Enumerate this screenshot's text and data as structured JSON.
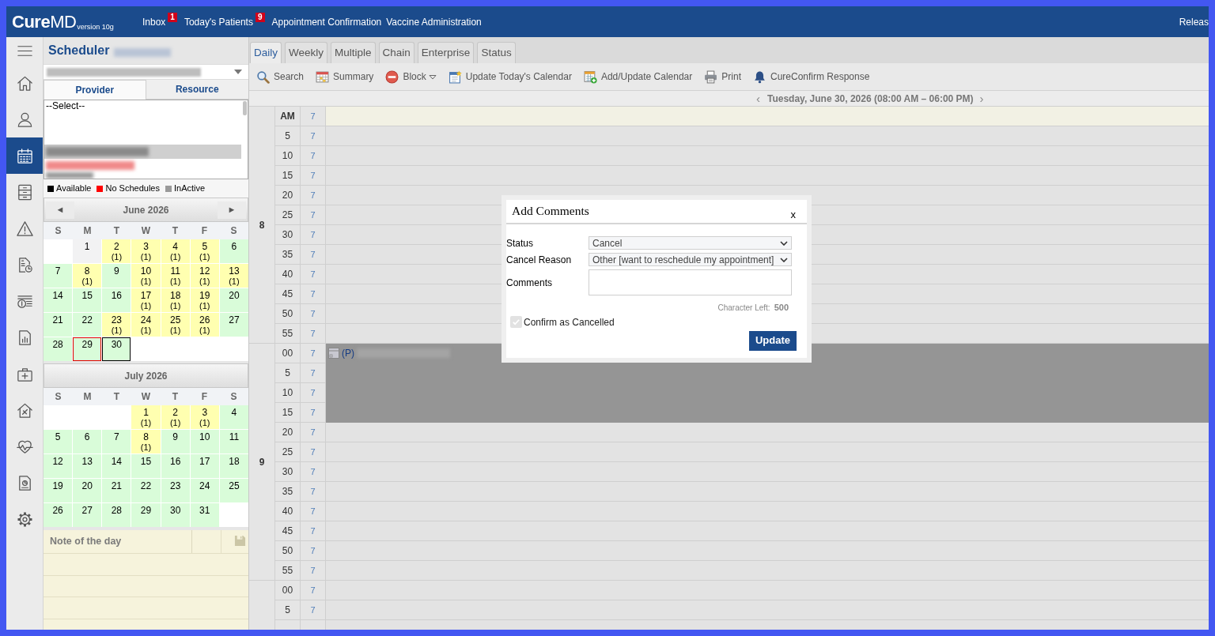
{
  "header": {
    "logo": "**Cure**MD",
    "version": "version 10g",
    "nav": [
      {
        "label": "Inbox",
        "badge": "1"
      },
      {
        "label": "Today's Patients",
        "badge": "9"
      },
      {
        "label": "Appointment Confirmation"
      },
      {
        "label": "Vaccine Administration"
      }
    ],
    "right_link": "Releas"
  },
  "rail": {
    "items": [
      {
        "kind": "menu",
        "selected": false
      },
      {
        "kind": "home",
        "selected": false
      },
      {
        "kind": "person",
        "selected": false
      },
      {
        "kind": "calendar",
        "selected": true
      },
      {
        "kind": "cabinet",
        "selected": false
      },
      {
        "kind": "warning",
        "selected": false
      },
      {
        "kind": "invoice",
        "selected": false
      },
      {
        "kind": "cash",
        "selected": false
      },
      {
        "kind": "report",
        "selected": false
      },
      {
        "kind": "bag",
        "selected": false
      },
      {
        "kind": "house",
        "selected": false
      },
      {
        "kind": "heart",
        "selected": false
      },
      {
        "kind": "chartdoc",
        "selected": false
      },
      {
        "kind": "gear",
        "selected": false
      }
    ]
  },
  "scheduler": {
    "title": "Scheduler",
    "tabs": [
      {
        "label": "Provider",
        "selected": true
      },
      {
        "label": "Resource",
        "selected": false
      }
    ],
    "list": [
      {
        "label": "--Select--"
      }
    ],
    "legend": [
      {
        "label": "Available",
        "color": "#000000"
      },
      {
        "label": "No Schedules",
        "color": "#ff0000"
      },
      {
        "label": "InActive",
        "color": "#999999"
      }
    ]
  },
  "calendars": [
    {
      "title": "June 2026",
      "prev": "◄",
      "next": "►",
      "weekdays": [
        "S",
        "M",
        "T",
        "W",
        "T",
        "F",
        "S"
      ],
      "weeks": [
        [
          {
            "kind": "blank"
          },
          {
            "day": "1",
            "kind": "closed",
            "selected": false,
            "today": false
          },
          {
            "day": "2",
            "count": "(1)",
            "kind": "booked",
            "selected": false,
            "today": false
          },
          {
            "day": "3",
            "count": "(1)",
            "kind": "booked",
            "selected": false,
            "today": false
          },
          {
            "day": "4",
            "count": "(1)",
            "kind": "booked",
            "selected": false,
            "today": false
          },
          {
            "day": "5",
            "count": "(1)",
            "kind": "booked",
            "selected": false,
            "today": false
          },
          {
            "day": "6",
            "kind": "open",
            "selected": false,
            "today": false
          }
        ],
        [
          {
            "day": "7",
            "kind": "open",
            "selected": false,
            "today": false
          },
          {
            "day": "8",
            "count": "(1)",
            "kind": "booked",
            "selected": false,
            "today": false
          },
          {
            "day": "9",
            "kind": "open",
            "selected": false,
            "today": false
          },
          {
            "day": "10",
            "count": "(1)",
            "kind": "booked",
            "selected": false,
            "today": false
          },
          {
            "day": "11",
            "count": "(1)",
            "kind": "booked",
            "selected": false,
            "today": false
          },
          {
            "day": "12",
            "count": "(1)",
            "kind": "booked",
            "selected": false,
            "today": false
          },
          {
            "day": "13",
            "count": "(1)",
            "kind": "booked",
            "selected": false,
            "today": false
          }
        ],
        [
          {
            "day": "14",
            "kind": "open",
            "selected": false,
            "today": false
          },
          {
            "day": "15",
            "kind": "open",
            "selected": false,
            "today": false
          },
          {
            "day": "16",
            "kind": "open",
            "selected": false,
            "today": false
          },
          {
            "day": "17",
            "count": "(1)",
            "kind": "booked",
            "selected": false,
            "today": false
          },
          {
            "day": "18",
            "count": "(1)",
            "kind": "booked",
            "selected": false,
            "today": false
          },
          {
            "day": "19",
            "count": "(1)",
            "kind": "booked",
            "selected": false,
            "today": false
          },
          {
            "day": "20",
            "kind": "open",
            "selected": false,
            "today": false
          }
        ],
        [
          {
            "day": "21",
            "kind": "open",
            "selected": false,
            "today": false
          },
          {
            "day": "22",
            "kind": "open",
            "selected": false,
            "today": false
          },
          {
            "day": "23",
            "count": "(1)",
            "kind": "booked",
            "selected": false,
            "today": false
          },
          {
            "day": "24",
            "count": "(1)",
            "kind": "booked",
            "selected": false,
            "today": false
          },
          {
            "day": "25",
            "count": "(1)",
            "kind": "booked",
            "selected": false,
            "today": false
          },
          {
            "day": "26",
            "count": "(1)",
            "kind": "booked",
            "selected": false,
            "today": false
          },
          {
            "day": "27",
            "kind": "open",
            "selected": false,
            "today": false
          }
        ],
        [
          {
            "day": "28",
            "kind": "open",
            "selected": false,
            "today": false
          },
          {
            "day": "29",
            "kind": "open",
            "selected": false,
            "today": true
          },
          {
            "day": "30",
            "kind": "open",
            "selected": true,
            "today": false
          }
        ]
      ]
    },
    {
      "title": "July 2026",
      "weekdays": [
        "S",
        "M",
        "T",
        "W",
        "T",
        "F",
        "S"
      ],
      "weeks": [
        [
          {
            "kind": "blank"
          },
          {
            "kind": "blank"
          },
          {
            "kind": "blank"
          },
          {
            "day": "1",
            "count": "(1)",
            "kind": "booked",
            "selected": false,
            "today": false
          },
          {
            "day": "2",
            "count": "(1)",
            "kind": "booked",
            "selected": false,
            "today": false
          },
          {
            "day": "3",
            "count": "(1)",
            "kind": "booked",
            "selected": false,
            "today": false
          },
          {
            "day": "4",
            "kind": "open",
            "selected": false,
            "today": false
          }
        ],
        [
          {
            "day": "5",
            "kind": "open",
            "selected": false,
            "today": false
          },
          {
            "day": "6",
            "kind": "open",
            "selected": false,
            "today": false
          },
          {
            "day": "7",
            "kind": "open",
            "selected": false,
            "today": false
          },
          {
            "day": "8",
            "count": "(1)",
            "kind": "booked",
            "selected": false,
            "today": false
          },
          {
            "day": "9",
            "kind": "open",
            "selected": false,
            "today": false
          },
          {
            "day": "10",
            "kind": "open",
            "selected": false,
            "today": false
          },
          {
            "day": "11",
            "kind": "open",
            "selected": false,
            "today": false
          }
        ],
        [
          {
            "day": "12",
            "kind": "open",
            "selected": false,
            "today": false
          },
          {
            "day": "13",
            "kind": "open",
            "selected": false,
            "today": false
          },
          {
            "day": "14",
            "kind": "open",
            "selected": false,
            "today": false
          },
          {
            "day": "15",
            "kind": "open",
            "selected": false,
            "today": false
          },
          {
            "day": "16",
            "kind": "open",
            "selected": false,
            "today": false
          },
          {
            "day": "17",
            "kind": "open",
            "selected": false,
            "today": false
          },
          {
            "day": "18",
            "kind": "open",
            "selected": false,
            "today": false
          }
        ],
        [
          {
            "day": "19",
            "kind": "open",
            "selected": false,
            "today": false
          },
          {
            "day": "20",
            "kind": "open",
            "selected": false,
            "today": false
          },
          {
            "day": "21",
            "kind": "open",
            "selected": false,
            "today": false
          },
          {
            "day": "22",
            "kind": "open",
            "selected": false,
            "today": false
          },
          {
            "day": "23",
            "kind": "open",
            "selected": false,
            "today": false
          },
          {
            "day": "24",
            "kind": "open",
            "selected": false,
            "today": false
          },
          {
            "day": "25",
            "kind": "open",
            "selected": false,
            "today": false
          }
        ],
        [
          {
            "day": "26",
            "kind": "open",
            "selected": false,
            "today": false
          },
          {
            "day": "27",
            "kind": "open",
            "selected": false,
            "today": false
          },
          {
            "day": "28",
            "kind": "open",
            "selected": false,
            "today": false
          },
          {
            "day": "29",
            "kind": "open",
            "selected": false,
            "today": false
          },
          {
            "day": "30",
            "kind": "open",
            "selected": false,
            "today": false
          },
          {
            "day": "31",
            "kind": "open",
            "selected": false,
            "today": false
          }
        ]
      ]
    }
  ],
  "note": {
    "title": "Note of the day"
  },
  "main": {
    "tabs": [
      {
        "label": "Daily",
        "selected": true
      },
      {
        "label": "Weekly",
        "selected": false
      },
      {
        "label": "Multiple",
        "selected": false
      },
      {
        "label": "Chain",
        "selected": false
      },
      {
        "label": "Enterprise",
        "selected": false
      },
      {
        "label": "Status",
        "selected": false
      }
    ],
    "toolbar": [
      {
        "kind": "search",
        "label": "Search"
      },
      {
        "kind": "summary",
        "label": "Summary"
      },
      {
        "kind": "block",
        "label": "Block",
        "menu": true
      },
      {
        "kind": "update",
        "label": "Update Today's Calendar"
      },
      {
        "kind": "add",
        "label": "Add/Update Calendar"
      },
      {
        "kind": "print",
        "label": "Print"
      },
      {
        "kind": "bell",
        "label": "CureConfirm Response"
      }
    ],
    "date_nav": {
      "prev": "‹",
      "label": "Tuesday, June 30, 2026 (08:00 AM – 06:00 PM)",
      "next": "›"
    }
  },
  "schedule": {
    "hours": [
      {
        "hour": "8",
        "rows": [
          {
            "kind": "heading",
            "minute": "AM",
            "slot": "7",
            "booked": false
          },
          {
            "kind": "slot",
            "minute": "5",
            "slot": "7",
            "booked": false
          },
          {
            "kind": "slot",
            "minute": "10",
            "slot": "7",
            "booked": false
          },
          {
            "kind": "slot",
            "minute": "15",
            "slot": "7",
            "booked": false
          },
          {
            "kind": "slot",
            "minute": "20",
            "slot": "7",
            "booked": false
          },
          {
            "kind": "slot",
            "minute": "25",
            "slot": "7",
            "booked": false
          },
          {
            "kind": "slot",
            "minute": "30",
            "slot": "7",
            "booked": false
          },
          {
            "kind": "slot",
            "minute": "35",
            "slot": "7",
            "booked": false
          },
          {
            "kind": "slot",
            "minute": "40",
            "slot": "7",
            "booked": false
          },
          {
            "kind": "slot",
            "minute": "45",
            "slot": "7",
            "booked": false
          },
          {
            "kind": "slot",
            "minute": "50",
            "slot": "7",
            "booked": false
          },
          {
            "kind": "slot",
            "minute": "55",
            "slot": "7",
            "booked": false
          }
        ]
      },
      {
        "hour": "9",
        "rows": [
          {
            "kind": "slot",
            "minute": "00",
            "slot": "7",
            "booked": true,
            "appointment": {
              "tag": "(P)"
            }
          },
          {
            "kind": "slot",
            "minute": "5",
            "slot": "7",
            "booked": true
          },
          {
            "kind": "slot",
            "minute": "10",
            "slot": "7",
            "booked": true
          },
          {
            "kind": "slot",
            "minute": "15",
            "slot": "7",
            "booked": true
          },
          {
            "kind": "slot",
            "minute": "20",
            "slot": "7",
            "booked": false
          },
          {
            "kind": "slot",
            "minute": "25",
            "slot": "7",
            "booked": false
          },
          {
            "kind": "slot",
            "minute": "30",
            "slot": "7",
            "booked": false
          },
          {
            "kind": "slot",
            "minute": "35",
            "slot": "7",
            "booked": false
          },
          {
            "kind": "slot",
            "minute": "40",
            "slot": "7",
            "booked": false
          },
          {
            "kind": "slot",
            "minute": "45",
            "slot": "7",
            "booked": false
          },
          {
            "kind": "slot",
            "minute": "50",
            "slot": "7",
            "booked": false
          },
          {
            "kind": "slot",
            "minute": "55",
            "slot": "7",
            "booked": false
          }
        ]
      },
      {
        "rows": [
          {
            "kind": "slot",
            "minute": "00",
            "slot": "7",
            "booked": false
          },
          {
            "kind": "slot",
            "minute": "5",
            "slot": "7",
            "booked": false
          }
        ]
      }
    ]
  },
  "dialog": {
    "title": "Add Comments",
    "close": "x",
    "fields": [
      {
        "kind": "select",
        "label": "Status",
        "value": "Cancel"
      },
      {
        "kind": "select",
        "label": "Cancel Reason",
        "value": "Other [want to reschedule my appointment]"
      },
      {
        "kind": "textarea",
        "label": "Comments"
      }
    ],
    "char_left": {
      "label": "Character Left:",
      "value": "500"
    },
    "checkbox": {
      "label": "Confirm as Cancelled",
      "checked": true,
      "disabled": true
    },
    "button": "Update"
  }
}
